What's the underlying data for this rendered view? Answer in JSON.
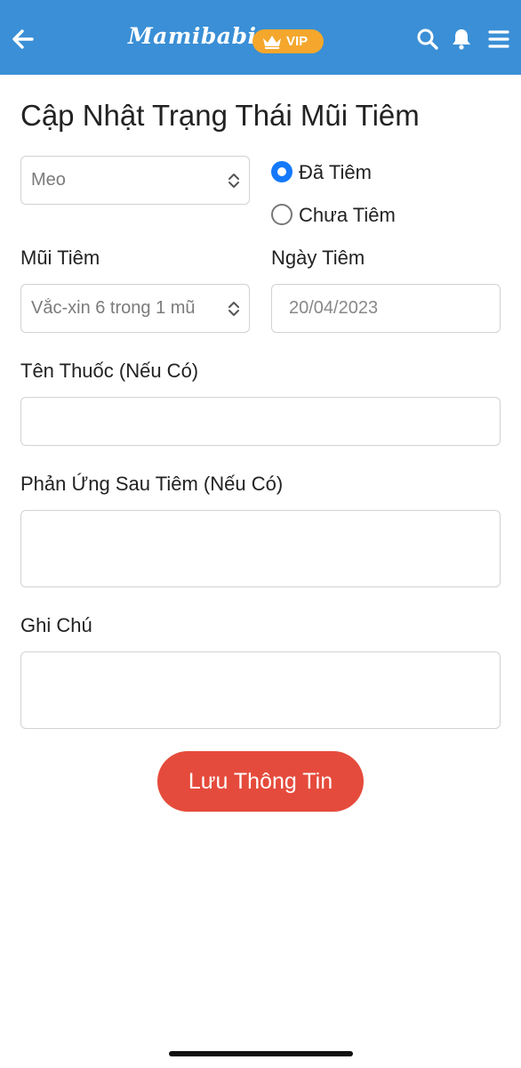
{
  "header": {
    "background_color": "#3a8fd6",
    "back_icon": "arrow-left-icon",
    "logo_text": "Mamibabi",
    "vip_badge": {
      "label": "VIP",
      "color": "#f4a72c",
      "icon": "crown-icon"
    },
    "actions": [
      {
        "name": "search",
        "icon": "search-icon"
      },
      {
        "name": "notifications",
        "icon": "bell-icon"
      },
      {
        "name": "menu",
        "icon": "hamburger-menu-icon"
      }
    ]
  },
  "page": {
    "title": "Cập Nhật Trạng Thái Mũi Tiêm"
  },
  "form": {
    "child_select": {
      "value": "Meo"
    },
    "status": {
      "options": [
        {
          "label": "Đã Tiêm",
          "selected": true
        },
        {
          "label": "Chưa Tiêm",
          "selected": false
        }
      ]
    },
    "vaccine": {
      "label": "Mũi Tiêm",
      "value": "Vắc-xin 6 trong 1 mũ"
    },
    "date": {
      "label": "Ngày Tiêm",
      "value": "20/04/2023"
    },
    "medicine": {
      "label": "Tên Thuốc (Nếu Có)",
      "value": ""
    },
    "reaction": {
      "label": "Phản Ứng Sau Tiêm (Nếu Có)",
      "value": ""
    },
    "note": {
      "label": "Ghi Chú",
      "value": ""
    },
    "submit_label": "Lưu Thông Tin",
    "submit_color": "#e54b3c",
    "radio_color": "#1479fb"
  }
}
